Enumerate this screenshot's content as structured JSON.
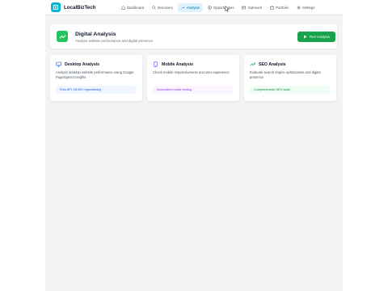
{
  "app": {
    "name": "LocalBizTech"
  },
  "nav": [
    {
      "label": "Dashboard",
      "icon": "home-icon"
    },
    {
      "label": "Discovery",
      "icon": "search-icon"
    },
    {
      "label": "Analysis",
      "icon": "trend-icon",
      "active": true
    },
    {
      "label": "Opportunities",
      "icon": "target-icon"
    },
    {
      "label": "Outreach",
      "icon": "mail-icon"
    },
    {
      "label": "Portfolio",
      "icon": "briefcase-icon"
    },
    {
      "label": "Settings",
      "icon": "gear-icon"
    }
  ],
  "header": {
    "title": "Digital Analysis",
    "subtitle": "Analyze website performance and digital presence",
    "run_label": "Run Analysis",
    "accent": "#22c55e"
  },
  "cards": [
    {
      "title": "Desktop Analysis",
      "description": "Analyze desktop website performance using Google PageSpeed Insights",
      "badge": "Free API: 25,000 requests/day",
      "icon": "monitor-icon"
    },
    {
      "title": "Mobile Analysis",
      "description": "Check mobile responsiveness and user experience",
      "badge": "Automated mobile testing",
      "icon": "smartphone-icon"
    },
    {
      "title": "SEO Analysis",
      "description": "Evaluate search engine optimization and digital presence",
      "badge": "Comprehensive SEO audit",
      "icon": "trend-icon"
    }
  ]
}
